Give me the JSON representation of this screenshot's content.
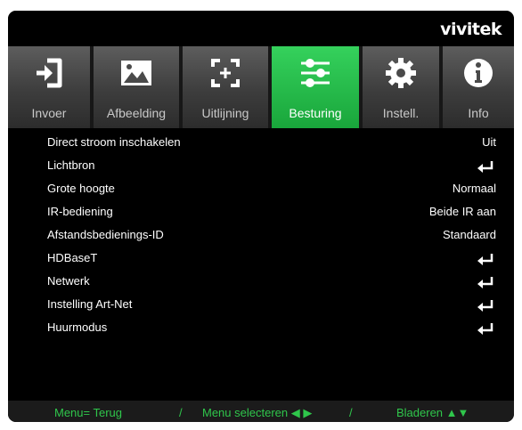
{
  "brand": "vivitek",
  "tabs": [
    {
      "label": "Invoer",
      "icon": "input-icon",
      "active": false
    },
    {
      "label": "Afbeelding",
      "icon": "image-icon",
      "active": false
    },
    {
      "label": "Uitlijning",
      "icon": "alignment-icon",
      "active": false
    },
    {
      "label": "Besturing",
      "icon": "sliders-icon",
      "active": true
    },
    {
      "label": "Instell.",
      "icon": "gear-icon",
      "active": false
    },
    {
      "label": "Info",
      "icon": "info-icon",
      "active": false
    }
  ],
  "menu": [
    {
      "label": "Direct stroom inschakelen",
      "value": "Uit"
    },
    {
      "label": "Lichtbron",
      "value": "",
      "enter": true
    },
    {
      "label": "Grote hoogte",
      "value": "Normaal"
    },
    {
      "label": "IR-bediening",
      "value": "Beide IR aan"
    },
    {
      "label": "Afstandsbedienings-ID",
      "value": "Standaard"
    },
    {
      "label": "HDBaseT",
      "value": "",
      "enter": true
    },
    {
      "label": "Netwerk",
      "value": "",
      "enter": true
    },
    {
      "label": "Instelling Art-Net",
      "value": "",
      "enter": true
    },
    {
      "label": "Huurmodus",
      "value": "",
      "enter": true
    }
  ],
  "footer": {
    "back": "Menu= Terug",
    "sep1": "/",
    "select": "Menu selecteren ◀ ▶",
    "sep2": "/",
    "browse": "Bladeren ▲▼"
  },
  "colors": {
    "active_tab": "#1fb043",
    "footer_text": "#2fc64b"
  }
}
